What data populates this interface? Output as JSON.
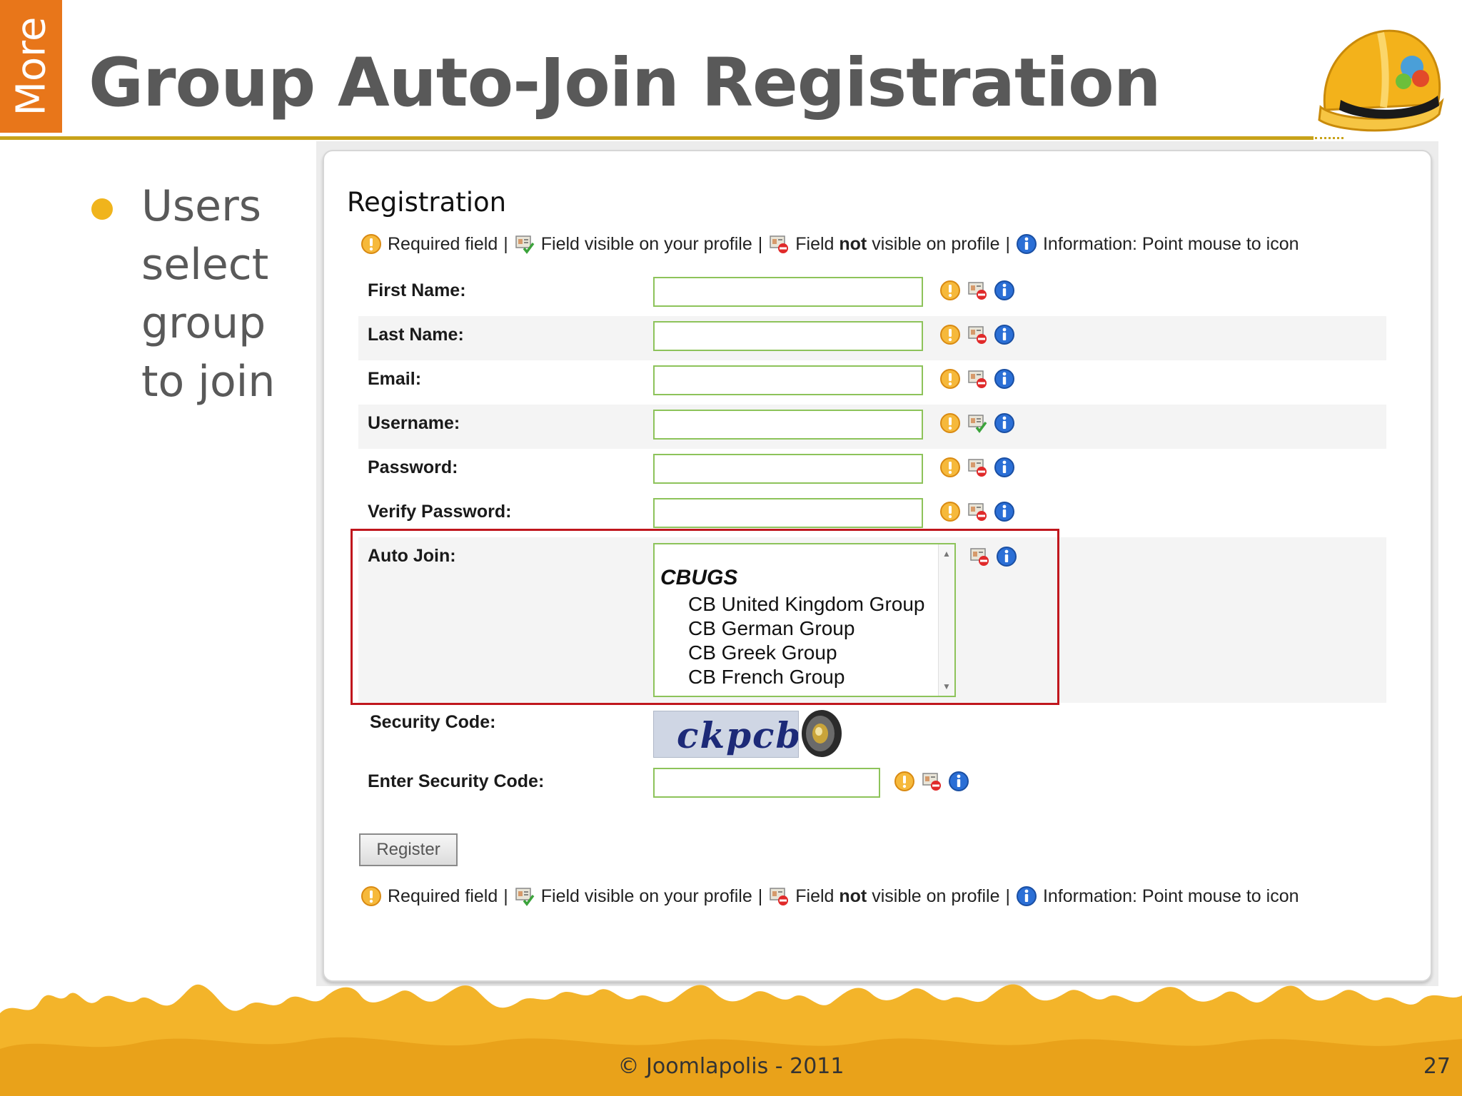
{
  "slide": {
    "side_tab": "More",
    "title": "Group Auto-Join Registration",
    "bullet": "Users select group to join",
    "footer": "© Joomlapolis - 2011",
    "page_number": "27"
  },
  "form": {
    "heading": "Registration",
    "legend": {
      "required": "Required field",
      "visible_pre": "Field visible on your profile",
      "not_visible_a": "Field ",
      "not_visible_b": "not",
      "not_visible_c": " visible on profile",
      "info": "Information: Point mouse to icon",
      "sep": "|"
    },
    "fields": [
      {
        "label": "First Name:",
        "value": ""
      },
      {
        "label": "Last Name:",
        "value": ""
      },
      {
        "label": "Email:",
        "value": ""
      },
      {
        "label": "Username:",
        "value": ""
      },
      {
        "label": "Password:",
        "value": ""
      },
      {
        "label": "Verify Password:",
        "value": ""
      }
    ],
    "auto_join": {
      "label": "Auto Join:",
      "group_header": "CBUGS",
      "options": [
        "CB United Kingdom Group",
        "CB German Group",
        "CB Greek Group",
        "CB French Group"
      ]
    },
    "security_code_label": "Security Code:",
    "captcha_text": "ckpcb",
    "enter_security_code_label": "Enter Security Code:",
    "register_button": "Register"
  },
  "colors": {
    "accent_orange": "#e8761a",
    "title_rule": "#c8a21a",
    "input_border": "#8dc35a",
    "highlight_border": "#c0161d"
  },
  "icons": [
    "required-icon",
    "profile-visible-icon",
    "profile-hidden-icon",
    "info-icon",
    "speaker-icon",
    "hard-hat-icon"
  ]
}
